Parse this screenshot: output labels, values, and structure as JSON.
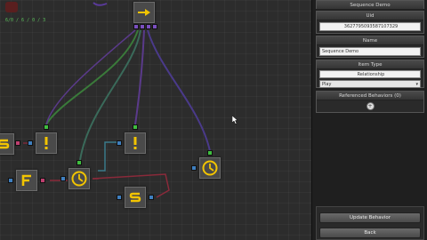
{
  "canvas": {
    "status_text": "6/0 / 6 / 0 / 3",
    "nodes": [
      {
        "id": "sequence",
        "icon": "arrow-right-icon"
      },
      {
        "id": "selector-left",
        "icon": "selector-s-icon"
      },
      {
        "id": "condition-1",
        "icon": "exclamation-icon"
      },
      {
        "id": "condition-2",
        "icon": "exclamation-icon"
      },
      {
        "id": "fail",
        "icon": "failer-f-icon"
      },
      {
        "id": "wait-1",
        "icon": "clock-icon"
      },
      {
        "id": "selector",
        "icon": "selector-s-icon"
      },
      {
        "id": "wait-2",
        "icon": "clock-icon"
      }
    ],
    "colors": {
      "wire_green": "#3a7a3a",
      "wire_purple": "#5a3a8a",
      "wire_red": "#8a2a3a",
      "wire_teal": "#3a7a8a",
      "icon_yellow": "#f2c400"
    }
  },
  "panel": {
    "title": "Sequence Demo",
    "uid_header": "Uid",
    "uid_value": "3627795093587107329",
    "name_header": "Name",
    "name_value": "Sequence Demo",
    "item_type_header": "Item Type",
    "item_type_value": "Relationship",
    "item_type_select": "Play",
    "referenced_header": "Referenced Behaviors (0)",
    "add_symbol": "+",
    "update_button": "Update Behavior",
    "back_button": "Back"
  }
}
